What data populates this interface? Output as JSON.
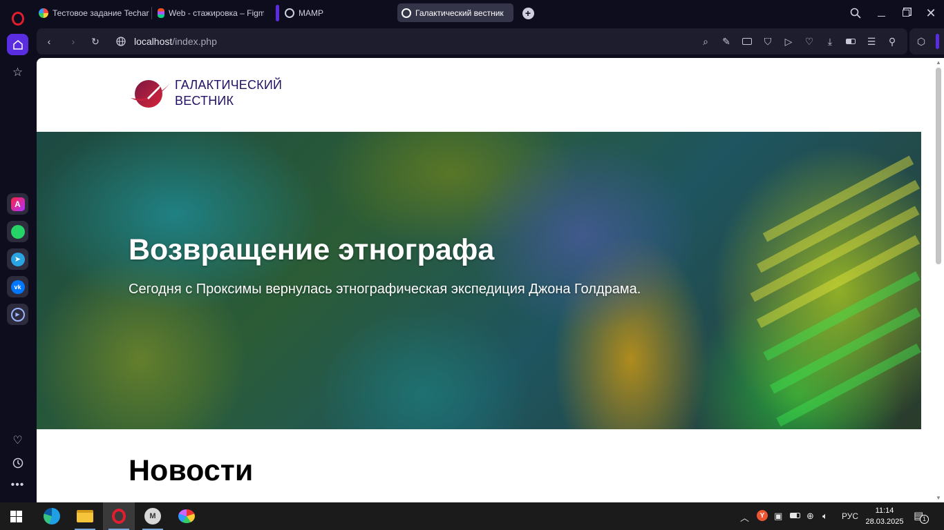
{
  "tabs": [
    {
      "label": "Тестовое задание Techart",
      "favicon": "colorful-logo"
    },
    {
      "label": "Web - стажировка – Figm",
      "favicon": "figma-logo"
    },
    {
      "label": "MAMP",
      "favicon": "globe-icon"
    },
    {
      "label": "Галактический вестник",
      "favicon": "globe-icon",
      "active": true
    }
  ],
  "toolbar": {
    "url_host": "localhost",
    "url_path": "/index.php"
  },
  "site": {
    "logo_line1": "ГАЛАКТИЧЕСКИЙ",
    "logo_line2": "ВЕСТНИК",
    "hero_title": "Возвращение этнографа",
    "hero_subtitle": "Сегодня с Проксимы вернулась этнографическая экспедиция Джона Голдрама.",
    "section_title": "Новости"
  },
  "taskbar": {
    "lang": "РУС",
    "time": "11:14",
    "date": "28.03.2025",
    "notification_count": "1"
  },
  "colors": {
    "accent": "#5a2de0",
    "logo": "#231066",
    "logo_planet": "#c2203f"
  }
}
